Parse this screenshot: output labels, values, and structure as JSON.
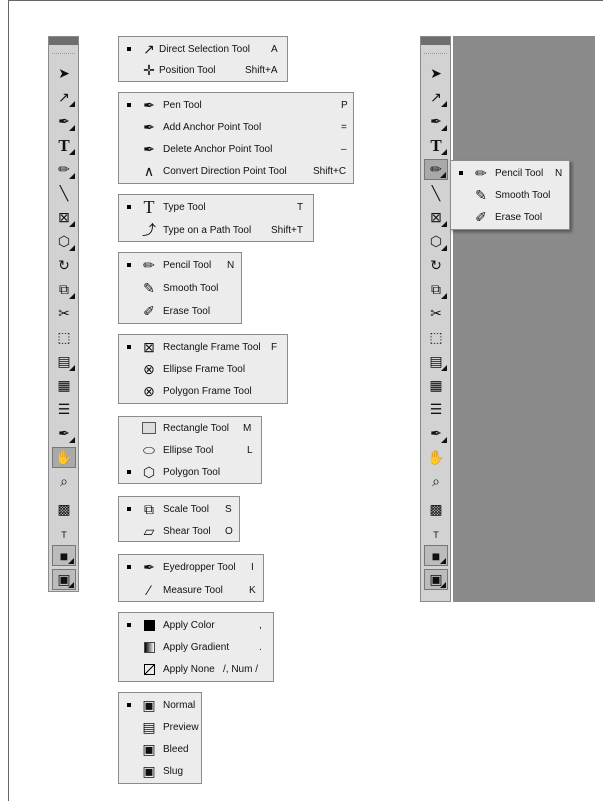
{
  "left_toolbar": {
    "tools": [
      "selection-arrow",
      "direct-selection-arrow",
      "pen",
      "type",
      "pencil",
      "line",
      "rectangle-frame",
      "polygon",
      "rotate",
      "scale",
      "scissors",
      "free-transform",
      "gradient",
      "gradient-feather",
      "note",
      "eyedropper",
      "hand",
      "zoom",
      "fill-stroke",
      "formatting",
      "apply-color",
      "view-mode"
    ],
    "type_glyph": "T",
    "formatting_glyph": "T"
  },
  "panels": {
    "selection": {
      "items": [
        {
          "label": "Direct Selection Tool",
          "shortcut": "A",
          "active": true,
          "icon": "direct-selection-icon"
        },
        {
          "label": "Position Tool",
          "shortcut": "Shift+A",
          "active": false,
          "icon": "position-icon"
        }
      ]
    },
    "pen": {
      "items": [
        {
          "label": "Pen Tool",
          "shortcut": "P",
          "active": true,
          "icon": "pen-icon"
        },
        {
          "label": "Add Anchor Point Tool",
          "shortcut": "=",
          "active": false,
          "icon": "add-anchor-icon"
        },
        {
          "label": "Delete Anchor Point Tool",
          "shortcut": "–",
          "active": false,
          "icon": "delete-anchor-icon"
        },
        {
          "label": "Convert Direction Point Tool",
          "shortcut": "Shift+C",
          "active": false,
          "icon": "convert-point-icon"
        }
      ]
    },
    "type": {
      "items": [
        {
          "label": "Type Tool",
          "shortcut": "T",
          "active": true,
          "icon": "type-icon"
        },
        {
          "label": "Type on a Path Tool",
          "shortcut": "Shift+T",
          "active": false,
          "icon": "type-path-icon"
        }
      ]
    },
    "pencil": {
      "items": [
        {
          "label": "Pencil Tool",
          "shortcut": "N",
          "active": true,
          "icon": "pencil-icon"
        },
        {
          "label": "Smooth Tool",
          "shortcut": "",
          "active": false,
          "icon": "smooth-icon"
        },
        {
          "label": "Erase Tool",
          "shortcut": "",
          "active": false,
          "icon": "erase-icon"
        }
      ]
    },
    "frame": {
      "items": [
        {
          "label": "Rectangle Frame Tool",
          "shortcut": "F",
          "active": true,
          "icon": "rectangle-frame-icon"
        },
        {
          "label": "Ellipse Frame Tool",
          "shortcut": "",
          "active": false,
          "icon": "ellipse-frame-icon"
        },
        {
          "label": "Polygon Frame Tool",
          "shortcut": "",
          "active": false,
          "icon": "polygon-frame-icon"
        }
      ]
    },
    "shape": {
      "items": [
        {
          "label": "Rectangle Tool",
          "shortcut": "M",
          "active": false,
          "icon": "rectangle-icon"
        },
        {
          "label": "Ellipse Tool",
          "shortcut": "L",
          "active": false,
          "icon": "ellipse-icon"
        },
        {
          "label": "Polygon Tool",
          "shortcut": "",
          "active": true,
          "icon": "polygon-icon"
        }
      ]
    },
    "scale": {
      "items": [
        {
          "label": "Scale Tool",
          "shortcut": "S",
          "active": true,
          "icon": "scale-icon"
        },
        {
          "label": "Shear Tool",
          "shortcut": "O",
          "active": false,
          "icon": "shear-icon"
        }
      ]
    },
    "eyedropper": {
      "items": [
        {
          "label": "Eyedropper Tool",
          "shortcut": "I",
          "active": true,
          "icon": "eyedropper-icon"
        },
        {
          "label": "Measure Tool",
          "shortcut": "K",
          "active": false,
          "icon": "measure-icon"
        }
      ]
    },
    "apply": {
      "items": [
        {
          "label": "Apply Color",
          "shortcut": ",",
          "active": true,
          "icon": "apply-color-icon"
        },
        {
          "label": "Apply Gradient",
          "shortcut": ".",
          "active": false,
          "icon": "apply-gradient-icon"
        },
        {
          "label": "Apply None",
          "shortcut": "/, Num /",
          "active": false,
          "icon": "apply-none-icon"
        }
      ]
    },
    "view": {
      "items": [
        {
          "label": "Normal",
          "shortcut": "",
          "active": true,
          "icon": "normal-view-icon"
        },
        {
          "label": "Preview",
          "shortcut": "",
          "active": false,
          "icon": "preview-view-icon"
        },
        {
          "label": "Bleed",
          "shortcut": "",
          "active": false,
          "icon": "bleed-view-icon"
        },
        {
          "label": "Slug",
          "shortcut": "",
          "active": false,
          "icon": "slug-view-icon"
        }
      ]
    }
  },
  "right_flyout": {
    "items": [
      {
        "label": "Pencil Tool",
        "shortcut": "N",
        "active": true,
        "icon": "pencil-icon"
      },
      {
        "label": "Smooth Tool",
        "shortcut": "",
        "active": false,
        "icon": "smooth-icon"
      },
      {
        "label": "Erase Tool",
        "shortcut": "",
        "active": false,
        "icon": "erase-icon"
      }
    ]
  },
  "colors": {
    "toolbar_bg": "#d2d2d2",
    "panel_bg": "#ececec",
    "canvas_gray": "#8a8a8a",
    "selected_tool": "#a9a9a9"
  }
}
